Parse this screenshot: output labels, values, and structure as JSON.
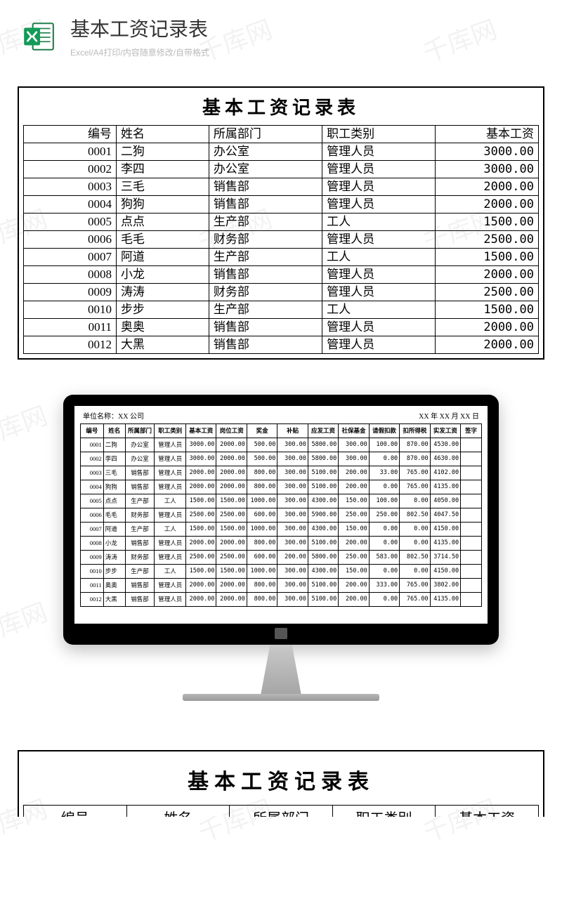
{
  "header": {
    "title": "基本工资记录表",
    "subtitle": "Excel/A4打印/内容随意修改/自带格式",
    "icon_name": "excel-icon"
  },
  "watermark_text": "千库网",
  "basic_table": {
    "title": "基本工资记录表",
    "columns": [
      "编号",
      "姓名",
      "所属部门",
      "职工类别",
      "基本工资"
    ],
    "rows": [
      {
        "id": "0001",
        "name": "二狗",
        "dept": "办公室",
        "cat": "管理人员",
        "salary": "3000.00"
      },
      {
        "id": "0002",
        "name": "李四",
        "dept": "办公室",
        "cat": "管理人员",
        "salary": "3000.00"
      },
      {
        "id": "0003",
        "name": "三毛",
        "dept": "销售部",
        "cat": "管理人员",
        "salary": "2000.00"
      },
      {
        "id": "0004",
        "name": "狗狗",
        "dept": "销售部",
        "cat": "管理人员",
        "salary": "2000.00"
      },
      {
        "id": "0005",
        "name": "点点",
        "dept": "生产部",
        "cat": "工人",
        "salary": "1500.00"
      },
      {
        "id": "0006",
        "name": "毛毛",
        "dept": "财务部",
        "cat": "管理人员",
        "salary": "2500.00"
      },
      {
        "id": "0007",
        "name": "阿道",
        "dept": "生产部",
        "cat": "工人",
        "salary": "1500.00"
      },
      {
        "id": "0008",
        "name": "小龙",
        "dept": "销售部",
        "cat": "管理人员",
        "salary": "2000.00"
      },
      {
        "id": "0009",
        "name": "涛涛",
        "dept": "财务部",
        "cat": "管理人员",
        "salary": "2500.00"
      },
      {
        "id": "0010",
        "name": "步步",
        "dept": "生产部",
        "cat": "工人",
        "salary": "1500.00"
      },
      {
        "id": "0011",
        "name": "奥奥",
        "dept": "销售部",
        "cat": "管理人员",
        "salary": "2000.00"
      },
      {
        "id": "0012",
        "name": "大黑",
        "dept": "销售部",
        "cat": "管理人员",
        "salary": "2000.00"
      }
    ]
  },
  "detail_table": {
    "meta_left": "单位名称：XX 公司",
    "meta_right": "XX 年 XX 月 XX 日",
    "columns": [
      "编号",
      "姓名",
      "所属部门",
      "职工类别",
      "基本工资",
      "岗位工资",
      "奖金",
      "补贴",
      "应发工资",
      "社保基金",
      "请假扣款",
      "扣所得税",
      "实发工资",
      "签字"
    ],
    "rows": [
      [
        "0001",
        "二狗",
        "办公室",
        "管理人员",
        "3000.00",
        "2000.00",
        "500.00",
        "300.00",
        "5800.00",
        "300.00",
        "100.00",
        "870.00",
        "4530.00",
        ""
      ],
      [
        "0002",
        "李四",
        "办公室",
        "管理人员",
        "3000.00",
        "2000.00",
        "500.00",
        "300.00",
        "5800.00",
        "300.00",
        "0.00",
        "870.00",
        "4630.00",
        ""
      ],
      [
        "0003",
        "三毛",
        "销售部",
        "管理人员",
        "2000.00",
        "2000.00",
        "800.00",
        "300.00",
        "5100.00",
        "200.00",
        "33.00",
        "765.00",
        "4102.00",
        ""
      ],
      [
        "0004",
        "狗狗",
        "销售部",
        "管理人员",
        "2000.00",
        "2000.00",
        "800.00",
        "300.00",
        "5100.00",
        "200.00",
        "0.00",
        "765.00",
        "4135.00",
        ""
      ],
      [
        "0005",
        "点点",
        "生产部",
        "工人",
        "1500.00",
        "1500.00",
        "1000.00",
        "300.00",
        "4300.00",
        "150.00",
        "100.00",
        "0.00",
        "4050.00",
        ""
      ],
      [
        "0006",
        "毛毛",
        "财务部",
        "管理人员",
        "2500.00",
        "2500.00",
        "600.00",
        "300.00",
        "5900.00",
        "250.00",
        "250.00",
        "802.50",
        "4047.50",
        ""
      ],
      [
        "0007",
        "阿道",
        "生产部",
        "工人",
        "1500.00",
        "1500.00",
        "1000.00",
        "300.00",
        "4300.00",
        "150.00",
        "0.00",
        "0.00",
        "4150.00",
        ""
      ],
      [
        "0008",
        "小龙",
        "销售部",
        "管理人员",
        "2000.00",
        "2000.00",
        "800.00",
        "300.00",
        "5100.00",
        "200.00",
        "0.00",
        "0.00",
        "4135.00",
        ""
      ],
      [
        "0009",
        "涛涛",
        "财务部",
        "管理人员",
        "2500.00",
        "2500.00",
        "600.00",
        "200.00",
        "5800.00",
        "250.00",
        "583.00",
        "802.50",
        "3714.50",
        ""
      ],
      [
        "0010",
        "步步",
        "生产部",
        "工人",
        "1500.00",
        "1500.00",
        "1000.00",
        "300.00",
        "4300.00",
        "150.00",
        "0.00",
        "0.00",
        "4150.00",
        ""
      ],
      [
        "0011",
        "奥奥",
        "销售部",
        "管理人员",
        "2000.00",
        "2000.00",
        "800.00",
        "300.00",
        "5100.00",
        "200.00",
        "333.00",
        "765.00",
        "3802.00",
        ""
      ],
      [
        "0012",
        "大黑",
        "销售部",
        "管理人员",
        "2000.00",
        "2000.00",
        "800.00",
        "300.00",
        "5100.00",
        "200.00",
        "0.00",
        "765.00",
        "4135.00",
        ""
      ]
    ]
  },
  "bottom_panel": {
    "title": "基本工资记录表",
    "columns": [
      "编号",
      "姓名",
      "所属部门",
      "职工类别",
      "基本工资"
    ]
  }
}
